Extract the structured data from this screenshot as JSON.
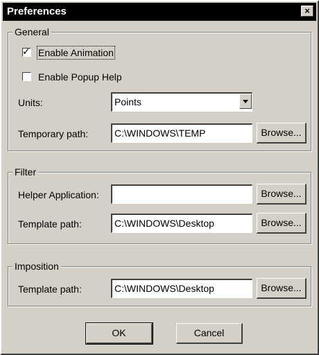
{
  "window": {
    "title": "Preferences",
    "close_glyph": "×",
    "close_icon": "close-icon"
  },
  "general": {
    "legend": "General",
    "enable_animation": {
      "label": "Enable Animation",
      "checked": true
    },
    "enable_popup_help": {
      "label": "Enable Popup Help",
      "checked": false
    },
    "units": {
      "label": "Units:",
      "value": "Points"
    },
    "temp_path": {
      "label": "Temporary path:",
      "value": "C:\\WINDOWS\\TEMP",
      "button": "Browse..."
    }
  },
  "filter": {
    "legend": "Filter",
    "helper_app": {
      "label": "Helper Application:",
      "value": "",
      "button": "Browse..."
    },
    "template_path": {
      "label": "Template path:",
      "value": "C:\\WINDOWS\\Desktop",
      "button": "Browse..."
    }
  },
  "imposition": {
    "legend": "Imposition",
    "template_path": {
      "label": "Template path:",
      "value": "C:\\WINDOWS\\Desktop",
      "button": "Browse..."
    }
  },
  "footer": {
    "ok": "OK",
    "cancel": "Cancel"
  },
  "colors": {
    "face": "#d4d0c8",
    "titlebar": "#000000",
    "field": "#ffffff"
  }
}
